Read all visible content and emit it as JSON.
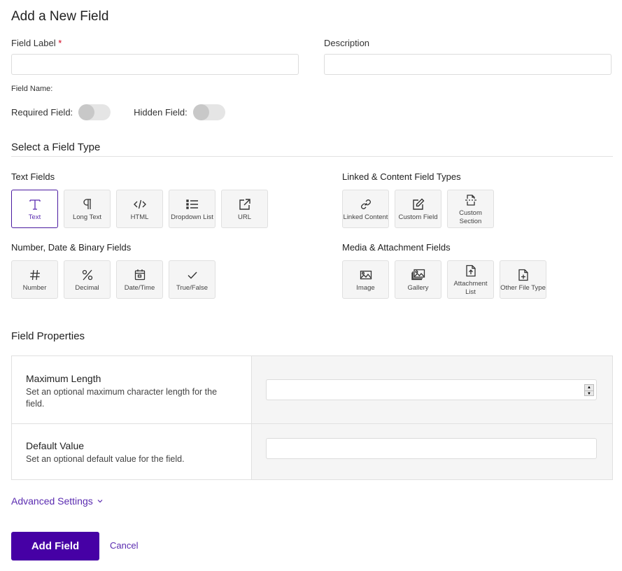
{
  "page": {
    "title": "Add a New Field"
  },
  "form": {
    "field_label": {
      "label": "Field Label",
      "required_mark": "*",
      "value": "",
      "placeholder": ""
    },
    "description": {
      "label": "Description",
      "value": "",
      "placeholder": ""
    },
    "field_name_label": "Field Name:",
    "required_toggle": {
      "label": "Required Field:",
      "on": false
    },
    "hidden_toggle": {
      "label": "Hidden Field:",
      "on": false
    }
  },
  "field_type": {
    "section_title": "Select a Field Type",
    "selected": "Text",
    "groups": [
      {
        "title": "Text Fields",
        "items": [
          {
            "label": "Text",
            "icon": "text-t-icon"
          },
          {
            "label": "Long Text",
            "icon": "pilcrow-icon"
          },
          {
            "label": "HTML",
            "icon": "code-icon"
          },
          {
            "label": "Dropdown List",
            "icon": "list-icon"
          },
          {
            "label": "URL",
            "icon": "external-link-icon"
          }
        ]
      },
      {
        "title": "Linked & Content Field Types",
        "items": [
          {
            "label": "Linked Content",
            "icon": "link-icon"
          },
          {
            "label": "Custom Field",
            "icon": "edit-icon"
          },
          {
            "label": "Custom Section",
            "icon": "section-icon"
          }
        ]
      },
      {
        "title": "Number, Date & Binary Fields",
        "items": [
          {
            "label": "Number",
            "icon": "hash-icon"
          },
          {
            "label": "Decimal",
            "icon": "percent-icon"
          },
          {
            "label": "Date/Time",
            "icon": "calendar-icon"
          },
          {
            "label": "True/False",
            "icon": "check-icon"
          }
        ]
      },
      {
        "title": "Media & Attachment Fields",
        "items": [
          {
            "label": "Image",
            "icon": "image-icon"
          },
          {
            "label": "Gallery",
            "icon": "gallery-icon"
          },
          {
            "label": "Attachment List",
            "icon": "file-upload-icon"
          },
          {
            "label": "Other File Type",
            "icon": "file-plus-icon"
          }
        ]
      }
    ]
  },
  "properties": {
    "title": "Field Properties",
    "rows": [
      {
        "name": "Maximum Length",
        "description": "Set an optional maximum character length for the field.",
        "value": ""
      },
      {
        "name": "Default Value",
        "description": "Set an optional default value for the field.",
        "value": ""
      }
    ]
  },
  "advanced": {
    "label": "Advanced Settings",
    "chevron": "⌄"
  },
  "actions": {
    "submit": "Add Field",
    "cancel": "Cancel"
  },
  "colors": {
    "accent": "#4600a5",
    "link": "#5a2bb0",
    "required": "#d0021b"
  }
}
